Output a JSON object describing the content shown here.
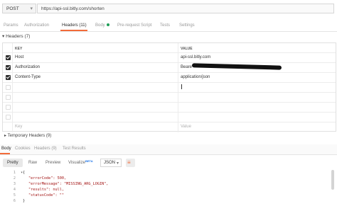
{
  "request": {
    "method": "POST",
    "url": "https://api-ssl.bitly.com/shorten"
  },
  "tabs": [
    {
      "label": "Params"
    },
    {
      "label": "Authorization"
    },
    {
      "label": "Headers (11)"
    },
    {
      "label": "Body"
    },
    {
      "label": "Pre-request Script"
    },
    {
      "label": "Tests"
    },
    {
      "label": "Settings"
    }
  ],
  "headers_section": {
    "title": "Headers (7)",
    "col_key": "KEY",
    "col_value": "VALUE",
    "rows": [
      {
        "key": "Host",
        "value": "api-ssl.bitly.com",
        "checked": true
      },
      {
        "key": "Authorization",
        "value": "Beare",
        "checked": true
      },
      {
        "key": "Content-Type",
        "value": "application/json",
        "checked": true
      }
    ],
    "placeholder_key": "Key",
    "placeholder_value": "Value",
    "temporary_headers": "Temporary Headers (9)"
  },
  "response": {
    "tabs": [
      {
        "label": "Body"
      },
      {
        "label": "Cookies"
      },
      {
        "label": "Headers (9)"
      },
      {
        "label": "Test Results"
      }
    ],
    "view_buttons": [
      {
        "label": "Pretty"
      },
      {
        "label": "Raw"
      },
      {
        "label": "Preview"
      },
      {
        "label": "Visualize"
      }
    ],
    "beta_badge": "BETA",
    "format": "JSON",
    "body_lines": [
      "{",
      "\"errorCode\": 500,",
      "\"errorMessage\": \"MISSING_ARG_LOGIN\",",
      "\"results\": null,",
      "\"statusCode\": \"\"",
      "}"
    ],
    "line_numbers": [
      "1",
      "2",
      "3",
      "4",
      "5",
      "6"
    ]
  },
  "colors": {
    "accent": "#f26b3a",
    "body_dot": "#1e9e57"
  }
}
